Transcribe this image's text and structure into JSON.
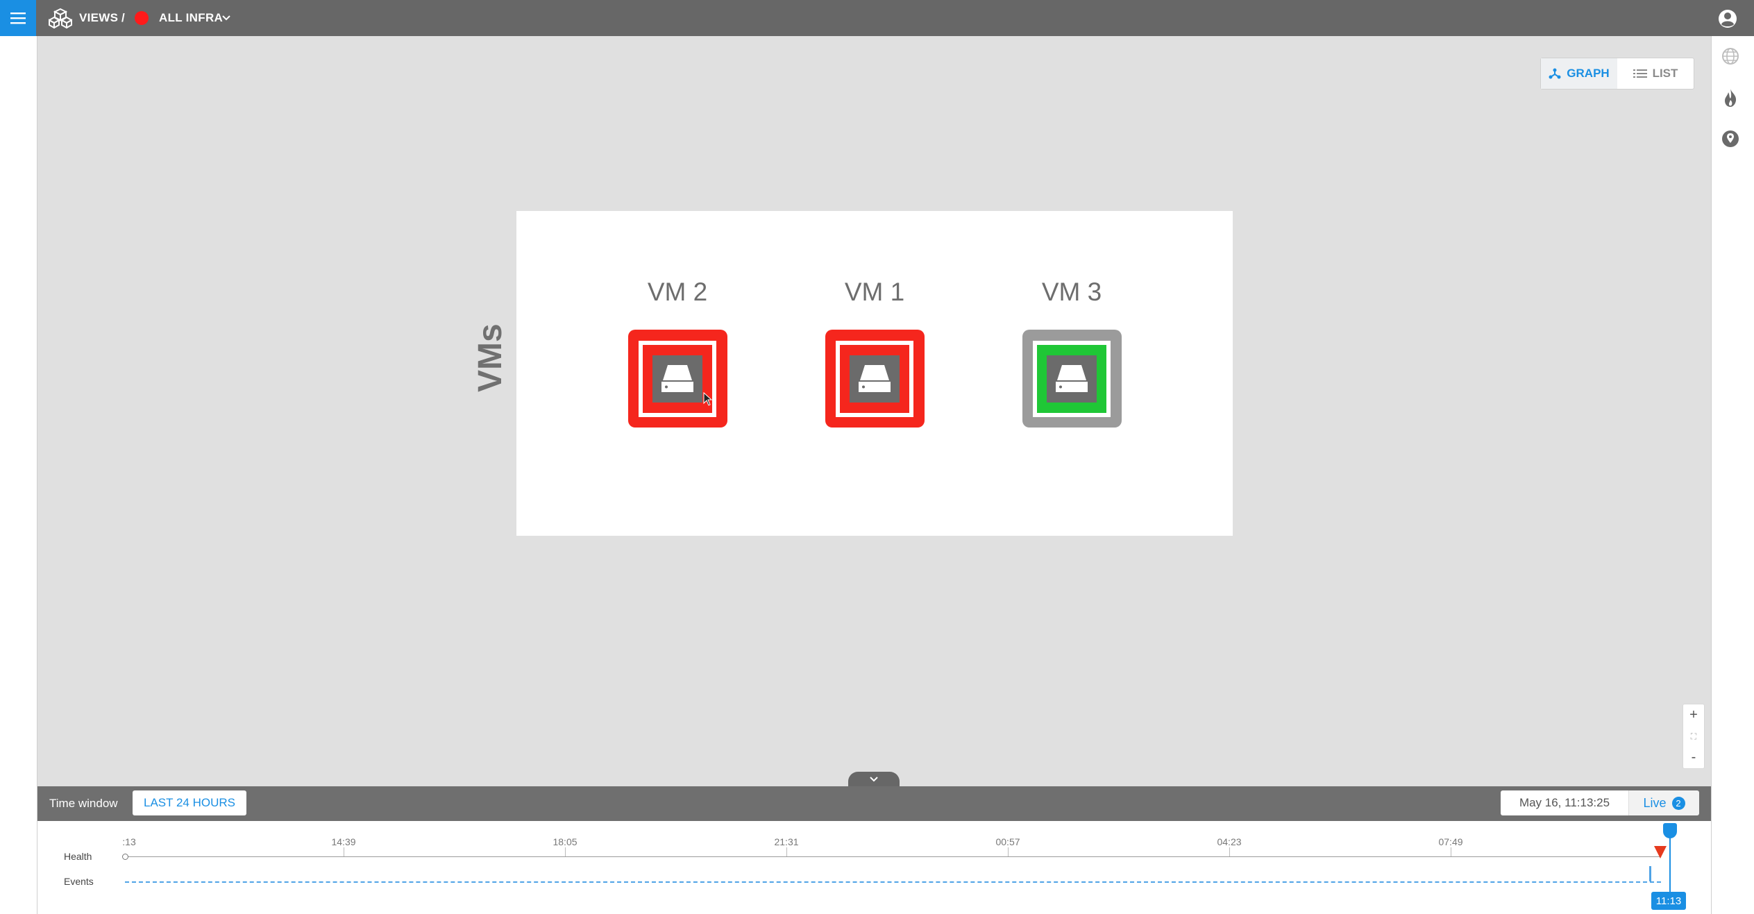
{
  "header": {
    "breadcrumb_root": "VIEWS",
    "separator": "/",
    "view_name": "ALL INFRA",
    "view_status_color": "#ff1a1a"
  },
  "view_toggle": {
    "graph_label": "GRAPH",
    "list_label": "LIST",
    "active": "GRAPH"
  },
  "canvas": {
    "group_label": "VMs",
    "nodes": [
      {
        "name": "VM 2",
        "status": "critical",
        "color": "#f5261d"
      },
      {
        "name": "VM 1",
        "status": "critical",
        "color": "#f5261d"
      },
      {
        "name": "VM 3",
        "status": "healthy",
        "color": "#1fc736",
        "border": "#9b9b9b"
      }
    ]
  },
  "zoom": {
    "in": "+",
    "fit": "⛶",
    "out": "-"
  },
  "time_window": {
    "label": "Time window",
    "range_button": "LAST 24 HOURS",
    "datetime": "May 16, 11:13:25",
    "live_label": "Live",
    "live_count": "2"
  },
  "timeline": {
    "rows": [
      "Health",
      "Events"
    ],
    "ticks": [
      ":13",
      "14:39",
      "18:05",
      "21:31",
      "00:57",
      "04:23",
      "07:49"
    ],
    "now_label": "11:13"
  },
  "colors": {
    "accent": "#1a8fe3",
    "critical": "#f5261d",
    "healthy": "#1fc736",
    "topbar": "#676767"
  }
}
